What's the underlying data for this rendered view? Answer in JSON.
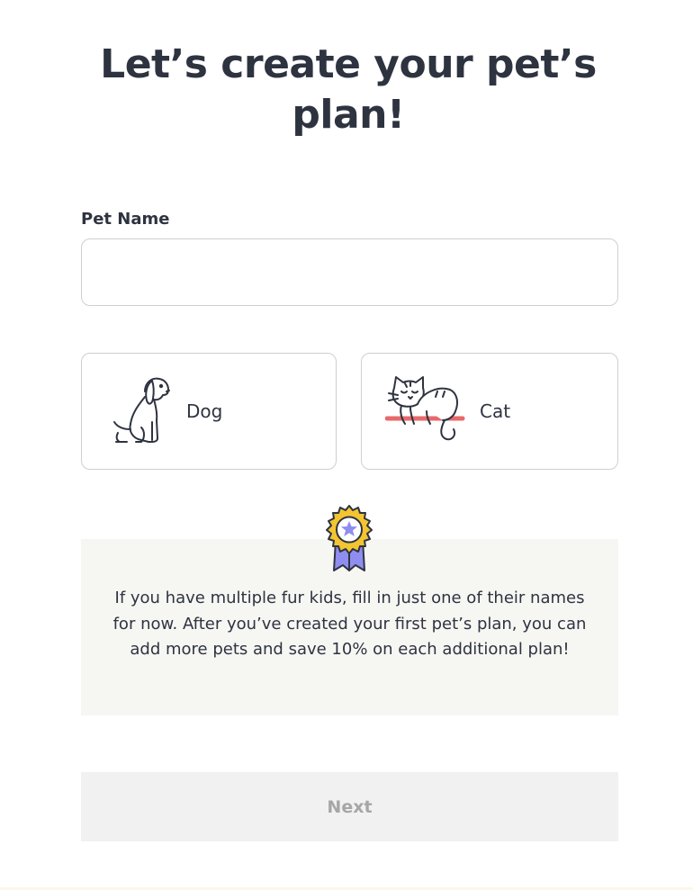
{
  "header": {
    "title": "Let’s create your pet’s plan!"
  },
  "form": {
    "pet_name_label": "Pet Name",
    "pet_name_value": "",
    "pet_name_placeholder": ""
  },
  "pet_types": [
    {
      "label": "Dog",
      "icon": "dog-icon"
    },
    {
      "label": "Cat",
      "icon": "cat-icon"
    }
  ],
  "info": {
    "icon": "award-ribbon-icon",
    "text": "If you have multiple fur kids, fill in just one of their names for now. After you’ve created your first pet’s plan, you can add more pets and save 10% on each additional plan!"
  },
  "actions": {
    "next_label": "Next"
  },
  "colors": {
    "text": "#2e3340",
    "border": "#cfcfcf",
    "info_background": "#f6f6f3",
    "button_background": "#f1f1f1",
    "button_text_disabled": "#a6a6a6",
    "badge_gold": "#f2c531",
    "badge_purple": "#8f8ef0",
    "cat_accent_red": "#e8696b"
  }
}
